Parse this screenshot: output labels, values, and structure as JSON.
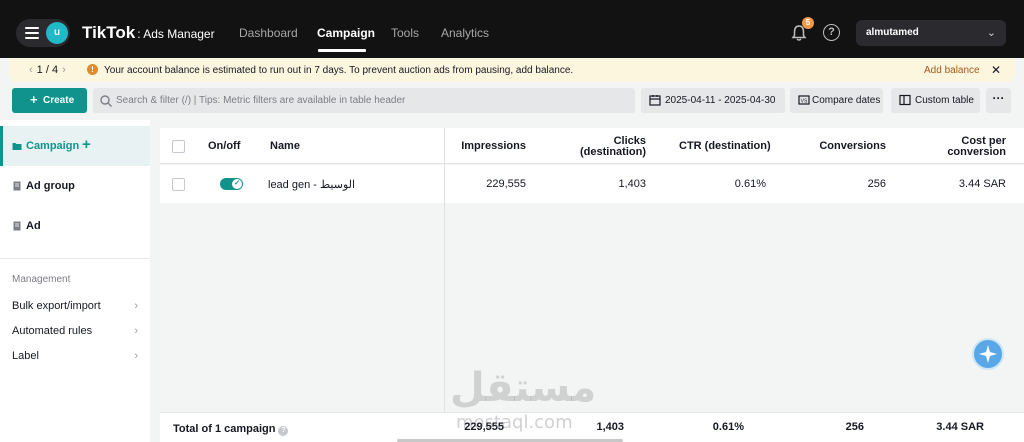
{
  "nav": {
    "avatar_letter": "u",
    "brand": "TikTok",
    "brand_sub": ": Ads Manager",
    "links": [
      "Dashboard",
      "Campaign",
      "Tools",
      "Analytics"
    ],
    "active_link": "Campaign",
    "notification_count": "5",
    "help_glyph": "?",
    "account_name": "almutamed"
  },
  "notice": {
    "pager": "1 / 4",
    "message": "Your account balance is estimated to run out in 7 days. To prevent auction ads from pausing, add balance.",
    "action": "Add balance"
  },
  "toolbar": {
    "create_label": "Create",
    "search_placeholder": "Search & filter (/) | Tips: Metric filters are available in table header",
    "date_range": "2025-04-11 - 2025-04-30",
    "compare_label": "Compare dates",
    "custom_table_label": "Custom table",
    "more_label": "···"
  },
  "sidebar": {
    "items": [
      {
        "label": "Campaign",
        "active": true
      },
      {
        "label": "Ad group",
        "active": false
      },
      {
        "label": "Ad",
        "active": false
      }
    ],
    "management_title": "Management",
    "management_items": [
      "Bulk export/import",
      "Automated rules",
      "Label"
    ]
  },
  "table": {
    "headers": {
      "onoff": "On/off",
      "name": "Name",
      "impressions": "Impressions",
      "clicks_1": "Clicks",
      "clicks_2": "(destination)",
      "ctr": "CTR (destination)",
      "conversions": "Conversions",
      "cpc_1": "Cost per",
      "cpc_2": "conversion"
    },
    "rows": [
      {
        "enabled": true,
        "name": "lead gen - الوسيط",
        "impressions": "229,555",
        "clicks": "1,403",
        "ctr": "0.61%",
        "conversions": "256",
        "cost_per_conversion": "3.44 SAR"
      }
    ],
    "total": {
      "label": "Total of 1 campaign",
      "impressions": "229,555",
      "clicks": "1,403",
      "ctr": "0.61%",
      "conversions": "256",
      "cost_per_conversion": "3.44 SAR"
    }
  },
  "watermark": {
    "arabic": "مستقل",
    "latin": "mostaql.com"
  },
  "colors": {
    "accent": "#10938c",
    "topbar": "#121212",
    "notice_bg": "#fdf6df",
    "warning": "#e08a2c",
    "badge": "#f2994a"
  },
  "icons": [
    "hamburger-icon",
    "bell-icon",
    "help-icon",
    "chevron-down-icon",
    "warning-icon",
    "close-icon",
    "plus-icon",
    "search-icon",
    "calendar-icon",
    "compare-icon",
    "table-icon",
    "folder-icon",
    "document-icon",
    "chevron-right-icon",
    "info-icon",
    "assistant-icon",
    "check-icon"
  ]
}
